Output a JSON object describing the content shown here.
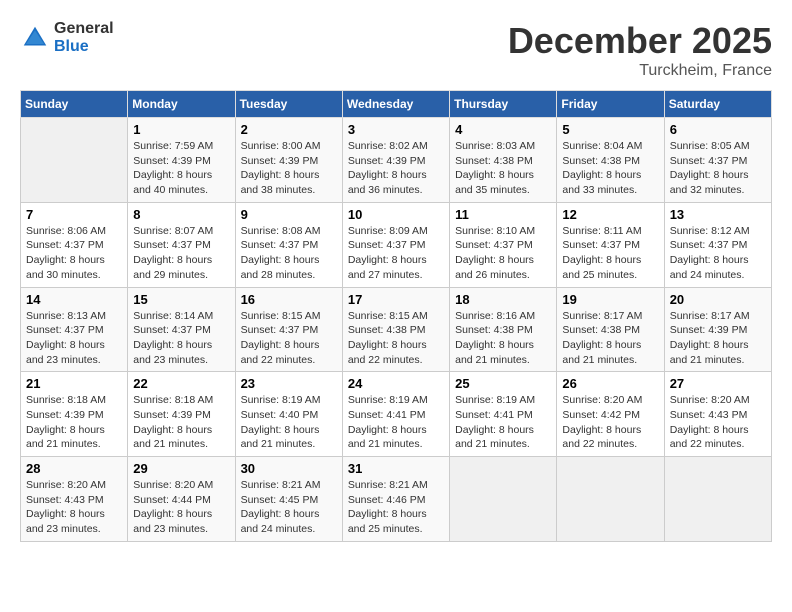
{
  "header": {
    "logo_general": "General",
    "logo_blue": "Blue",
    "month_title": "December 2025",
    "location": "Turckheim, France"
  },
  "days_of_week": [
    "Sunday",
    "Monday",
    "Tuesday",
    "Wednesday",
    "Thursday",
    "Friday",
    "Saturday"
  ],
  "weeks": [
    [
      {
        "day": "",
        "sunrise": "",
        "sunset": "",
        "daylight": ""
      },
      {
        "day": "1",
        "sunrise": "Sunrise: 7:59 AM",
        "sunset": "Sunset: 4:39 PM",
        "daylight": "Daylight: 8 hours and 40 minutes."
      },
      {
        "day": "2",
        "sunrise": "Sunrise: 8:00 AM",
        "sunset": "Sunset: 4:39 PM",
        "daylight": "Daylight: 8 hours and 38 minutes."
      },
      {
        "day": "3",
        "sunrise": "Sunrise: 8:02 AM",
        "sunset": "Sunset: 4:39 PM",
        "daylight": "Daylight: 8 hours and 36 minutes."
      },
      {
        "day": "4",
        "sunrise": "Sunrise: 8:03 AM",
        "sunset": "Sunset: 4:38 PM",
        "daylight": "Daylight: 8 hours and 35 minutes."
      },
      {
        "day": "5",
        "sunrise": "Sunrise: 8:04 AM",
        "sunset": "Sunset: 4:38 PM",
        "daylight": "Daylight: 8 hours and 33 minutes."
      },
      {
        "day": "6",
        "sunrise": "Sunrise: 8:05 AM",
        "sunset": "Sunset: 4:37 PM",
        "daylight": "Daylight: 8 hours and 32 minutes."
      }
    ],
    [
      {
        "day": "7",
        "sunrise": "Sunrise: 8:06 AM",
        "sunset": "Sunset: 4:37 PM",
        "daylight": "Daylight: 8 hours and 30 minutes."
      },
      {
        "day": "8",
        "sunrise": "Sunrise: 8:07 AM",
        "sunset": "Sunset: 4:37 PM",
        "daylight": "Daylight: 8 hours and 29 minutes."
      },
      {
        "day": "9",
        "sunrise": "Sunrise: 8:08 AM",
        "sunset": "Sunset: 4:37 PM",
        "daylight": "Daylight: 8 hours and 28 minutes."
      },
      {
        "day": "10",
        "sunrise": "Sunrise: 8:09 AM",
        "sunset": "Sunset: 4:37 PM",
        "daylight": "Daylight: 8 hours and 27 minutes."
      },
      {
        "day": "11",
        "sunrise": "Sunrise: 8:10 AM",
        "sunset": "Sunset: 4:37 PM",
        "daylight": "Daylight: 8 hours and 26 minutes."
      },
      {
        "day": "12",
        "sunrise": "Sunrise: 8:11 AM",
        "sunset": "Sunset: 4:37 PM",
        "daylight": "Daylight: 8 hours and 25 minutes."
      },
      {
        "day": "13",
        "sunrise": "Sunrise: 8:12 AM",
        "sunset": "Sunset: 4:37 PM",
        "daylight": "Daylight: 8 hours and 24 minutes."
      }
    ],
    [
      {
        "day": "14",
        "sunrise": "Sunrise: 8:13 AM",
        "sunset": "Sunset: 4:37 PM",
        "daylight": "Daylight: 8 hours and 23 minutes."
      },
      {
        "day": "15",
        "sunrise": "Sunrise: 8:14 AM",
        "sunset": "Sunset: 4:37 PM",
        "daylight": "Daylight: 8 hours and 23 minutes."
      },
      {
        "day": "16",
        "sunrise": "Sunrise: 8:15 AM",
        "sunset": "Sunset: 4:37 PM",
        "daylight": "Daylight: 8 hours and 22 minutes."
      },
      {
        "day": "17",
        "sunrise": "Sunrise: 8:15 AM",
        "sunset": "Sunset: 4:38 PM",
        "daylight": "Daylight: 8 hours and 22 minutes."
      },
      {
        "day": "18",
        "sunrise": "Sunrise: 8:16 AM",
        "sunset": "Sunset: 4:38 PM",
        "daylight": "Daylight: 8 hours and 21 minutes."
      },
      {
        "day": "19",
        "sunrise": "Sunrise: 8:17 AM",
        "sunset": "Sunset: 4:38 PM",
        "daylight": "Daylight: 8 hours and 21 minutes."
      },
      {
        "day": "20",
        "sunrise": "Sunrise: 8:17 AM",
        "sunset": "Sunset: 4:39 PM",
        "daylight": "Daylight: 8 hours and 21 minutes."
      }
    ],
    [
      {
        "day": "21",
        "sunrise": "Sunrise: 8:18 AM",
        "sunset": "Sunset: 4:39 PM",
        "daylight": "Daylight: 8 hours and 21 minutes."
      },
      {
        "day": "22",
        "sunrise": "Sunrise: 8:18 AM",
        "sunset": "Sunset: 4:39 PM",
        "daylight": "Daylight: 8 hours and 21 minutes."
      },
      {
        "day": "23",
        "sunrise": "Sunrise: 8:19 AM",
        "sunset": "Sunset: 4:40 PM",
        "daylight": "Daylight: 8 hours and 21 minutes."
      },
      {
        "day": "24",
        "sunrise": "Sunrise: 8:19 AM",
        "sunset": "Sunset: 4:41 PM",
        "daylight": "Daylight: 8 hours and 21 minutes."
      },
      {
        "day": "25",
        "sunrise": "Sunrise: 8:19 AM",
        "sunset": "Sunset: 4:41 PM",
        "daylight": "Daylight: 8 hours and 21 minutes."
      },
      {
        "day": "26",
        "sunrise": "Sunrise: 8:20 AM",
        "sunset": "Sunset: 4:42 PM",
        "daylight": "Daylight: 8 hours and 22 minutes."
      },
      {
        "day": "27",
        "sunrise": "Sunrise: 8:20 AM",
        "sunset": "Sunset: 4:43 PM",
        "daylight": "Daylight: 8 hours and 22 minutes."
      }
    ],
    [
      {
        "day": "28",
        "sunrise": "Sunrise: 8:20 AM",
        "sunset": "Sunset: 4:43 PM",
        "daylight": "Daylight: 8 hours and 23 minutes."
      },
      {
        "day": "29",
        "sunrise": "Sunrise: 8:20 AM",
        "sunset": "Sunset: 4:44 PM",
        "daylight": "Daylight: 8 hours and 23 minutes."
      },
      {
        "day": "30",
        "sunrise": "Sunrise: 8:21 AM",
        "sunset": "Sunset: 4:45 PM",
        "daylight": "Daylight: 8 hours and 24 minutes."
      },
      {
        "day": "31",
        "sunrise": "Sunrise: 8:21 AM",
        "sunset": "Sunset: 4:46 PM",
        "daylight": "Daylight: 8 hours and 25 minutes."
      },
      {
        "day": "",
        "sunrise": "",
        "sunset": "",
        "daylight": ""
      },
      {
        "day": "",
        "sunrise": "",
        "sunset": "",
        "daylight": ""
      },
      {
        "day": "",
        "sunrise": "",
        "sunset": "",
        "daylight": ""
      }
    ]
  ]
}
